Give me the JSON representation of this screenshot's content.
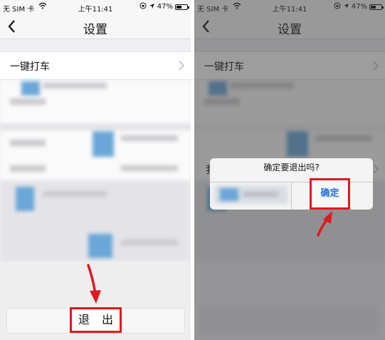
{
  "status_bar": {
    "carrier": "无 SIM 卡",
    "time": "上午11:41",
    "battery": "47%",
    "battery_level": 0.47
  },
  "nav": {
    "title": "设置"
  },
  "settings": {
    "one_click_taxi": "一键打车",
    "logout_label": "退 出"
  },
  "dialog": {
    "message": "确定要退出吗?",
    "confirm_label": "确定",
    "partial_row_char": "我"
  },
  "colors": {
    "highlight": "#e0181f",
    "link_blue": "#1a6fd6",
    "background": "#efeff4"
  },
  "icons": {
    "back": "chevron-left-icon",
    "row_arrow": "chevron-right-icon",
    "wifi": "wifi-icon",
    "location": "location-arrow-icon",
    "lock": "orientation-lock-icon",
    "battery": "battery-icon"
  }
}
